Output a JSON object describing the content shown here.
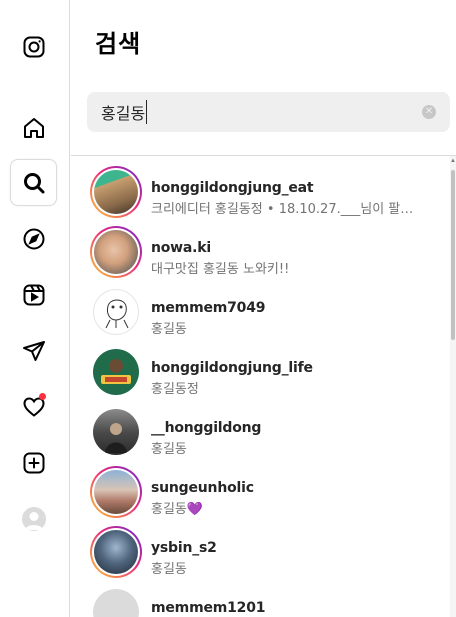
{
  "nav": {
    "items": [
      {
        "name": "instagram-logo",
        "icon": "instagram-icon"
      },
      {
        "name": "home",
        "icon": "home-icon"
      },
      {
        "name": "search",
        "icon": "search-icon",
        "active": true
      },
      {
        "name": "explore",
        "icon": "compass-icon"
      },
      {
        "name": "reels",
        "icon": "reels-icon"
      },
      {
        "name": "messages",
        "icon": "paper-plane-icon"
      },
      {
        "name": "notifications",
        "icon": "heart-icon",
        "badge": true
      },
      {
        "name": "create",
        "icon": "plus-square-icon"
      },
      {
        "name": "profile",
        "icon": "avatar"
      }
    ],
    "badge_color": "#ff3040"
  },
  "panel": {
    "title": "검색",
    "search": {
      "value": "홍길동",
      "clear_icon": "clear-circle-icon"
    }
  },
  "results": [
    {
      "username": "honggildongjung_eat",
      "subtitle": "크리에디터 홍길동정 • 18.10.27.___님이 팔…",
      "ring": true,
      "avatar_color": "#8a7c5a"
    },
    {
      "username": "nowa.ki",
      "subtitle": "대구맛집 홍길동 노와키!!",
      "ring": true,
      "avatar_color": "#c9a48a"
    },
    {
      "username": "memmem7049",
      "subtitle": "홍길동",
      "ring": false,
      "avatar_color": "#ffffff"
    },
    {
      "username": "honggildongjung_life",
      "subtitle": "홍길동정",
      "ring": false,
      "avatar_color": "#1f6b4a"
    },
    {
      "username": "__honggildong",
      "subtitle": "홍길동",
      "ring": false,
      "avatar_color": "#5a5a5a"
    },
    {
      "username": "sungeunholic",
      "subtitle": "홍길동",
      "subtitle_suffix": "💜",
      "ring": true,
      "avatar_color": "#b07a6a"
    },
    {
      "username": "ysbin_s2",
      "subtitle": "홍길동",
      "ring": true,
      "avatar_color": "#2c3a4a"
    },
    {
      "username": "memmem1201",
      "subtitle": "",
      "ring": false,
      "avatar_color": "#dbdbdb"
    }
  ],
  "colors": {
    "ring_start": "#f9ce34",
    "ring_mid": "#ee2a7b",
    "ring_end": "#6228d7",
    "search_bg": "#efefef"
  }
}
